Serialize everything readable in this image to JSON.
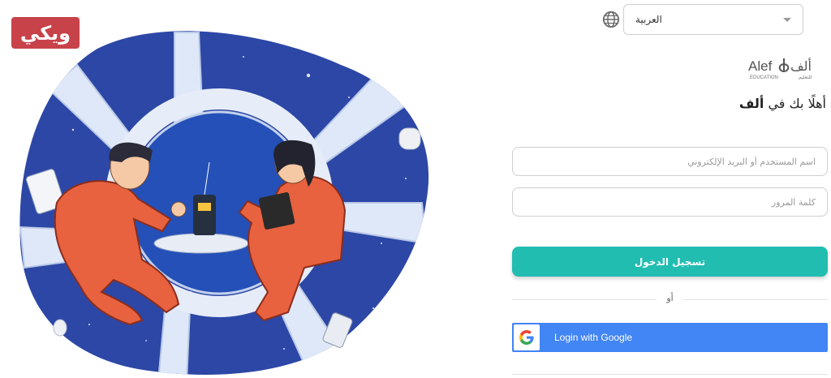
{
  "brand_badge": {
    "text": "ويكي",
    "color": "#c8424a"
  },
  "language": {
    "selected": "العربية",
    "icon": "globe-icon"
  },
  "logo": {
    "latin": "Alef",
    "arabic": "ألف",
    "sub_latin": "EDUCATION",
    "sub_arabic": "للتعليم"
  },
  "welcome": {
    "prefix": "أهلًا بك في",
    "brand": "ألف"
  },
  "form": {
    "username_placeholder": "اسم المستخدم أو البريد الإلكتروني",
    "password_placeholder": "كلمة المرور",
    "login_label": "تسجيل الدخول",
    "or_label": "أو",
    "google_label": "Login with Google"
  },
  "colors": {
    "accent": "#22bdb1",
    "google": "#4285f4",
    "space": "#2f4fb0"
  }
}
